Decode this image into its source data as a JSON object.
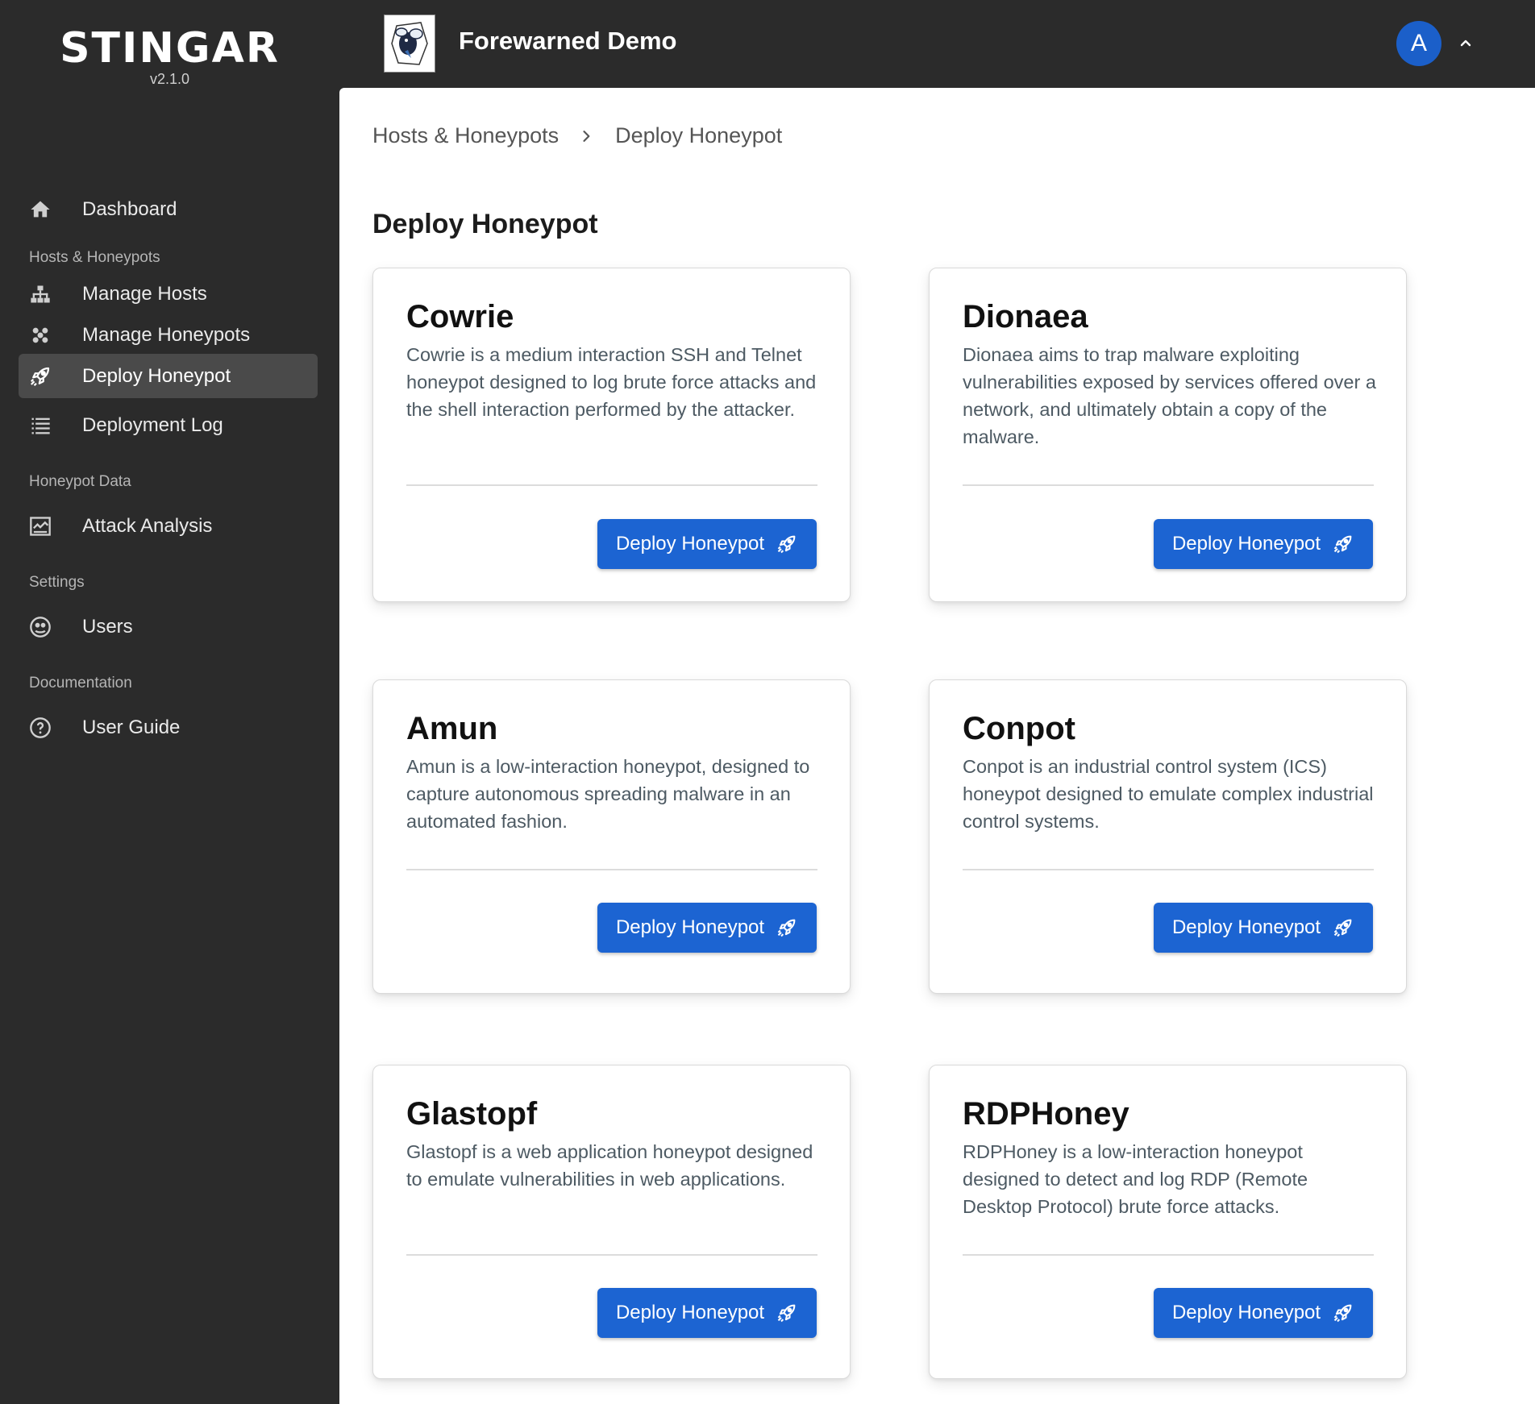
{
  "brand": {
    "name": "STINGAR",
    "version": "v2.1.0"
  },
  "header": {
    "org_name": "Forewarned Demo",
    "avatar_initial": "A"
  },
  "sidebar": {
    "items": [
      {
        "label": "Dashboard",
        "icon": "home-icon"
      },
      {
        "section": "Hosts & Honeypots"
      },
      {
        "label": "Manage Hosts",
        "icon": "hosts-icon"
      },
      {
        "label": "Manage Honeypots",
        "icon": "honeypots-icon"
      },
      {
        "label": "Deploy Honeypot",
        "icon": "rocket-icon",
        "active": true
      },
      {
        "label": "Deployment Log",
        "icon": "list-icon"
      },
      {
        "section": "Honeypot Data"
      },
      {
        "label": "Attack Analysis",
        "icon": "analysis-icon"
      },
      {
        "section": "Settings"
      },
      {
        "label": "Users",
        "icon": "users-icon"
      },
      {
        "section": "Documentation"
      },
      {
        "label": "User Guide",
        "icon": "help-icon"
      }
    ]
  },
  "breadcrumb": {
    "parent": "Hosts & Honeypots",
    "current": "Deploy Honeypot"
  },
  "page": {
    "title": "Deploy Honeypot"
  },
  "cards": [
    {
      "title": "Cowrie",
      "description": "Cowrie is a medium interaction SSH and Telnet honeypot designed to log brute force attacks and the shell interaction performed by the attacker.",
      "button": "Deploy Honeypot"
    },
    {
      "title": "Dionaea",
      "description": "Dionaea aims to trap malware exploiting vulnerabilities exposed by services offered over a network, and ultimately obtain a copy of the malware.",
      "button": "Deploy Honeypot"
    },
    {
      "title": "Amun",
      "description": "Amun is a low-interaction honeypot, designed to capture autonomous spreading malware in an automated fashion.",
      "button": "Deploy Honeypot"
    },
    {
      "title": "Conpot",
      "description": "Conpot is an industrial control system (ICS) honeypot designed to emulate complex industrial control systems.",
      "button": "Deploy Honeypot"
    },
    {
      "title": "Glastopf",
      "description": "Glastopf is a web application honeypot designed to emulate vulnerabilities in web applications.",
      "button": "Deploy Honeypot"
    },
    {
      "title": "RDPHoney",
      "description": "RDPHoney is a low-interaction honeypot designed to detect and log RDP (Remote Desktop Protocol) brute force attacks.",
      "button": "Deploy Honeypot"
    }
  ],
  "colors": {
    "primary": "#1c64d2",
    "sidebar_bg": "#2b2b2b",
    "active_item_bg": "#4a4a4a",
    "avatar_bg": "#1b5fc9"
  }
}
